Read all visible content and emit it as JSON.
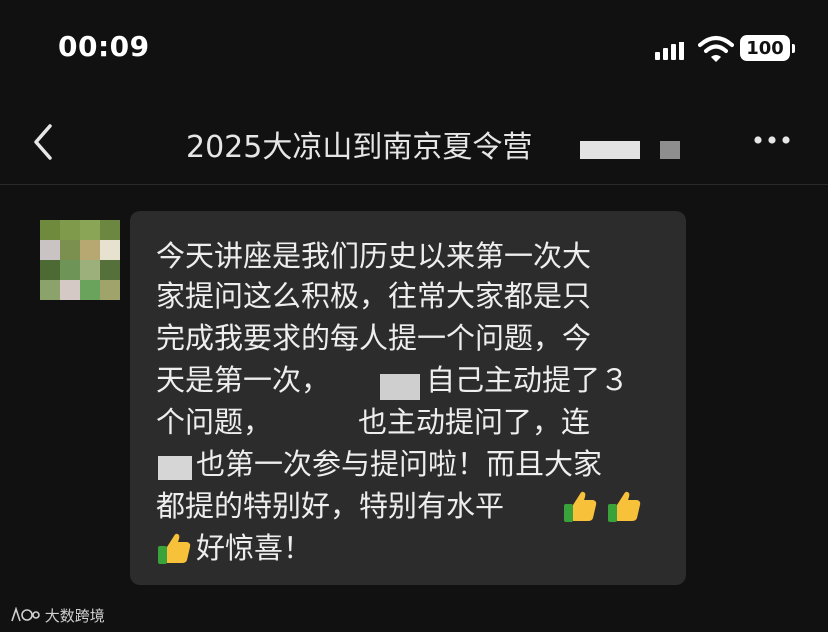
{
  "status_bar": {
    "time": "00:09",
    "battery": "100"
  },
  "nav": {
    "title": "2025大凉山到南京夏令营"
  },
  "message": {
    "lines": [
      "今天讲座是我们历史以来第一次大",
      "家提问这么积极，往常大家都是只",
      "完成我要求的每人提一个问题，今",
      "天是第一次，",
      "自己主动提了３",
      "个问题，",
      "也主动提问了，连",
      "也第一次参与提问啦！而且大家",
      "都提的特别好，特别有水平",
      "好惊喜！"
    ],
    "emoji": [
      "thumbs-up",
      "thumbs-up",
      "thumbs-up"
    ]
  },
  "watermark": "大数跨境",
  "colors": {
    "background": "#111111",
    "bubble": "#2c2c2c",
    "text": "#eeeeee"
  }
}
